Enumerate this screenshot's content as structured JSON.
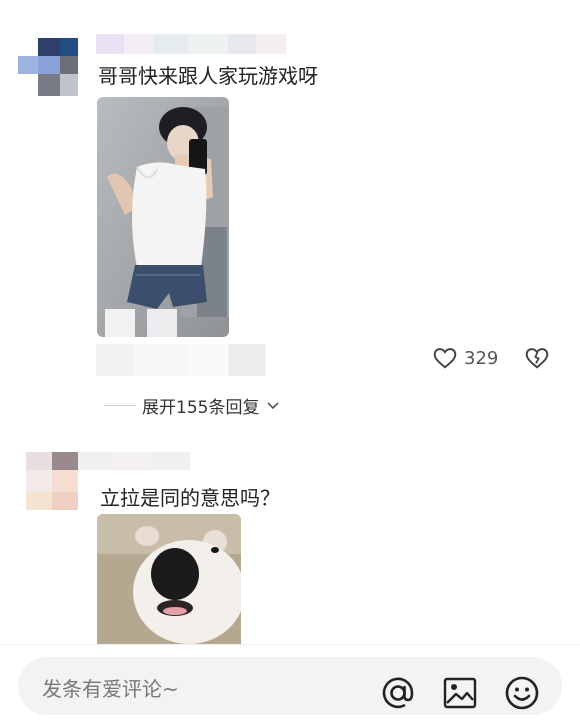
{
  "comments": [
    {
      "text": "哥哥快来跟人家玩游戏呀",
      "likes": "329",
      "expand_label": "展开155条回复"
    },
    {
      "text": "立拉是同的意思吗？"
    }
  ],
  "composer": {
    "placeholder": "发条有爱评论~"
  },
  "icons": {
    "like": "heart-icon",
    "dislike": "broken-heart-icon",
    "expand": "chevron-down-icon",
    "mention": "at-icon",
    "image": "image-icon",
    "emoji": "smiley-icon"
  },
  "colors": {
    "text": "#222222",
    "muted": "#777777",
    "input_bg": "#f3f3f3"
  }
}
